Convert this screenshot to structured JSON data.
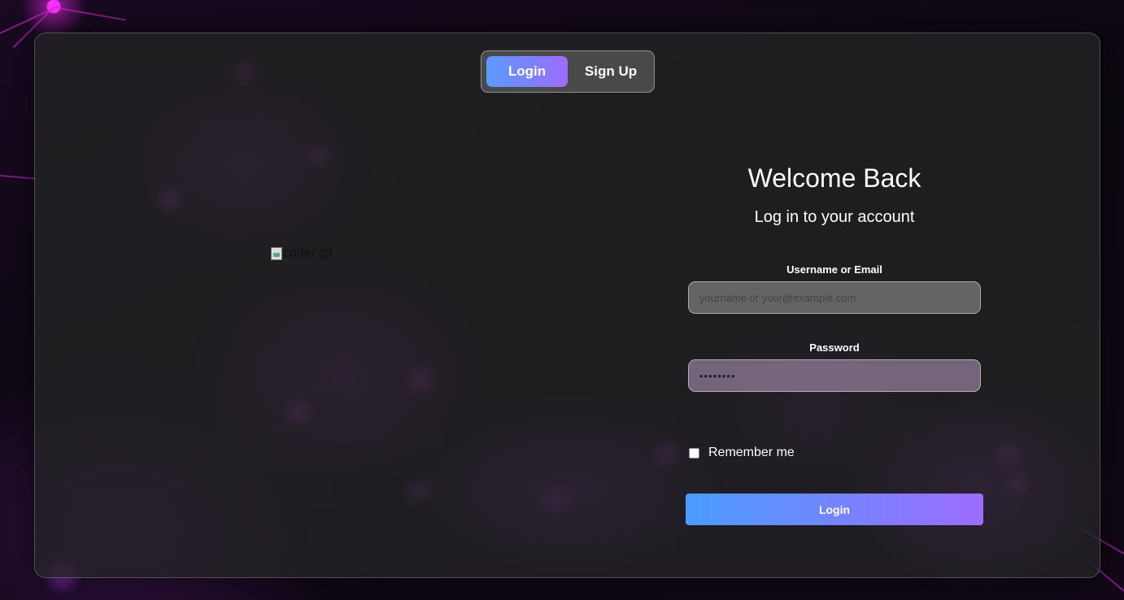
{
  "tabs": {
    "login_label": "Login",
    "signup_label": "Sign Up",
    "active": "login"
  },
  "image": {
    "alt": "coder gif"
  },
  "form": {
    "title": "Welcome Back",
    "subtitle": "Log in to your account",
    "username_label": "Username or Email",
    "username_placeholder": "yourname or your@example.com",
    "password_label": "Password",
    "password_value": "••••••••",
    "remember_label": "Remember me",
    "remember_checked": false,
    "submit_label": "Login"
  },
  "colors": {
    "accent_start": "#4a9cff",
    "accent_end": "#9d6cff",
    "background_glow": "#c026d3"
  }
}
